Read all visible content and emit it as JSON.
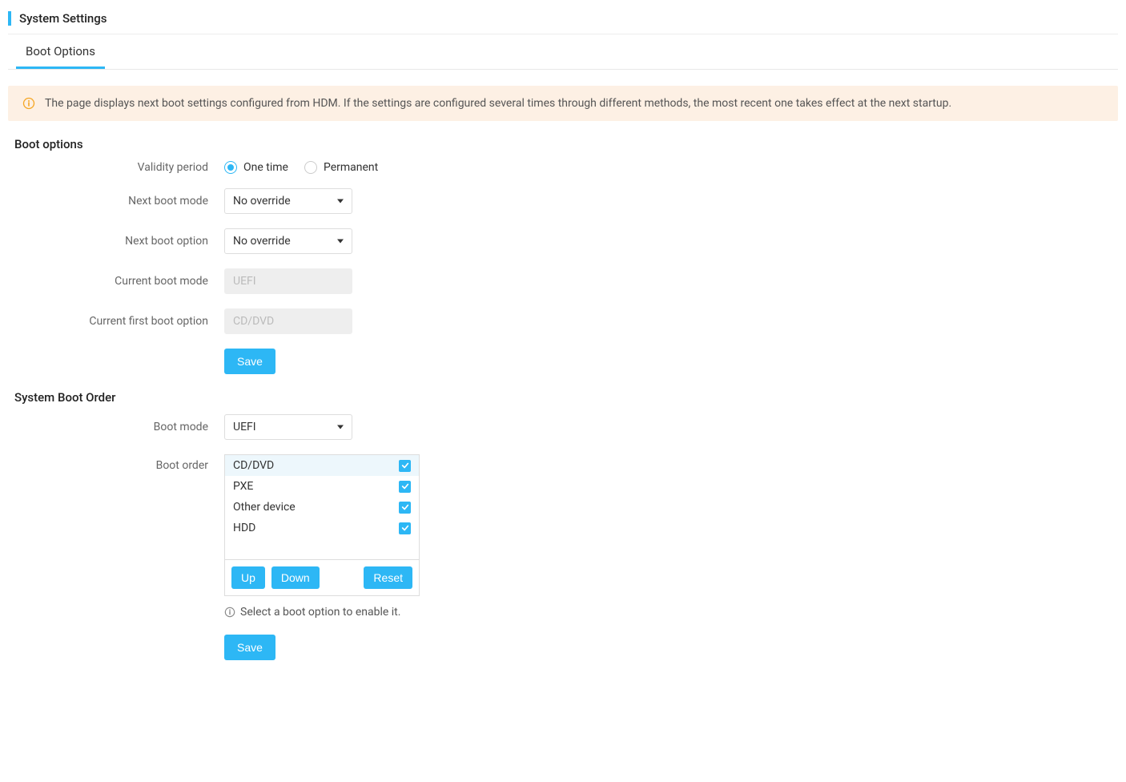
{
  "page": {
    "title": "System Settings"
  },
  "tabs": {
    "boot_options": "Boot Options"
  },
  "banner": {
    "text": "The page displays next boot settings configured from HDM. If the settings are configured several times through different methods, the most recent one takes effect at the next startup."
  },
  "boot_options_section": {
    "header": "Boot options",
    "validity_period_label": "Validity period",
    "validity_one_time": "One time",
    "validity_permanent": "Permanent",
    "next_boot_mode_label": "Next boot mode",
    "next_boot_mode_value": "No override",
    "next_boot_option_label": "Next boot option",
    "next_boot_option_value": "No override",
    "current_boot_mode_label": "Current boot mode",
    "current_boot_mode_value": "UEFI",
    "current_first_boot_option_label": "Current first boot option",
    "current_first_boot_option_value": "CD/DVD",
    "save_button": "Save"
  },
  "system_boot_order_section": {
    "header": "System Boot Order",
    "boot_mode_label": "Boot mode",
    "boot_mode_value": "UEFI",
    "boot_order_label": "Boot order",
    "items": [
      {
        "name": "CD/DVD",
        "checked": true,
        "selected": true
      },
      {
        "name": "PXE",
        "checked": true,
        "selected": false
      },
      {
        "name": "Other device",
        "checked": true,
        "selected": false
      },
      {
        "name": "HDD",
        "checked": true,
        "selected": false
      }
    ],
    "up_button": "Up",
    "down_button": "Down",
    "reset_button": "Reset",
    "hint": "Select a boot option to enable it.",
    "save_button": "Save"
  }
}
